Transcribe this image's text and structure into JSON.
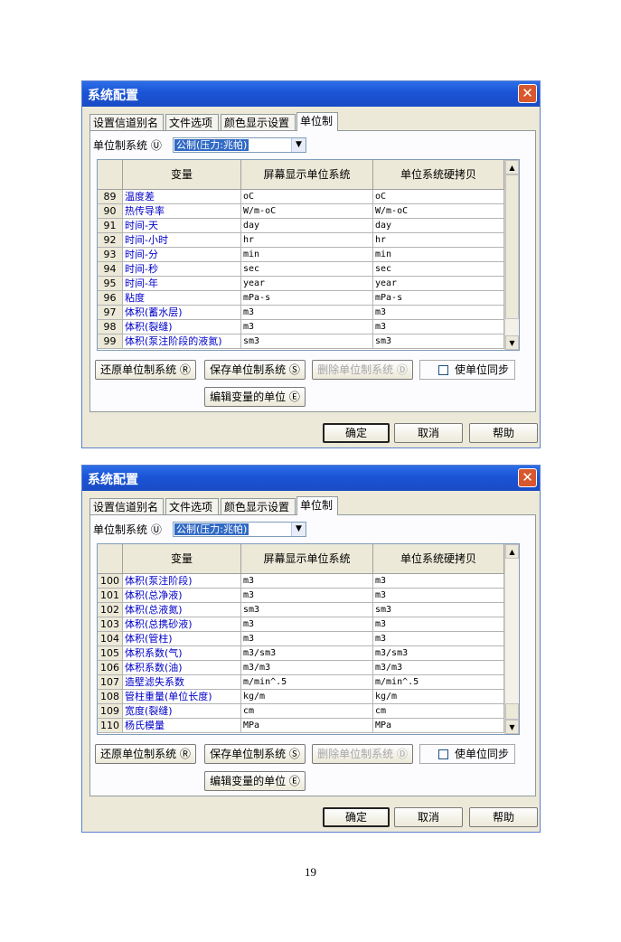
{
  "page_number": "19",
  "dialog1": {
    "title": "系统配置",
    "tabs": [
      "设置信道别名",
      "文件选项",
      "颜色显示设置",
      "单位制"
    ],
    "unit_system_label": "单位制系统 Ⓤ",
    "unit_system_value": "公制(压力:兆帕)",
    "headers": {
      "variable": "变量",
      "screen": "屏幕显示单位系统",
      "hardcopy": "单位系统硬拷贝"
    },
    "rows": [
      {
        "n": "89",
        "var": "温度差",
        "scr": "oC",
        "hc": "oC"
      },
      {
        "n": "90",
        "var": "热传导率",
        "scr": "W/m-oC",
        "hc": "W/m-oC"
      },
      {
        "n": "91",
        "var": "时间-天",
        "scr": "day",
        "hc": "day"
      },
      {
        "n": "92",
        "var": "时间-小时",
        "scr": "hr",
        "hc": "hr"
      },
      {
        "n": "93",
        "var": "时间-分",
        "scr": "min",
        "hc": "min"
      },
      {
        "n": "94",
        "var": "时间-秒",
        "scr": "sec",
        "hc": "sec"
      },
      {
        "n": "95",
        "var": "时间-年",
        "scr": "year",
        "hc": "year"
      },
      {
        "n": "96",
        "var": "粘度",
        "scr": "mPa-s",
        "hc": "mPa-s"
      },
      {
        "n": "97",
        "var": "体积(蓄水层)",
        "scr": "m3",
        "hc": "m3"
      },
      {
        "n": "98",
        "var": "体积(裂缝)",
        "scr": "m3",
        "hc": "m3"
      },
      {
        "n": "99",
        "var": "体积(泵注阶段的液氮)",
        "scr": "sm3",
        "hc": "sm3"
      }
    ],
    "buttons": {
      "restore": "还原单位制系统 Ⓡ",
      "save": "保存单位制系统 Ⓢ",
      "delete": "删除单位制系统 Ⓓ",
      "sync": "使单位同步",
      "edit": "编辑变量的单位 Ⓔ",
      "ok": "确定",
      "cancel": "取消",
      "help": "帮助"
    }
  },
  "dialog2": {
    "title": "系统配置",
    "tabs": [
      "设置信道别名",
      "文件选项",
      "颜色显示设置",
      "单位制"
    ],
    "unit_system_label": "单位制系统 Ⓤ",
    "unit_system_value": "公制(压力:兆帕)",
    "headers": {
      "variable": "变量",
      "screen": "屏幕显示单位系统",
      "hardcopy": "单位系统硬拷贝"
    },
    "rows": [
      {
        "n": "100",
        "var": "体积(泵注阶段)",
        "scr": "m3",
        "hc": "m3"
      },
      {
        "n": "101",
        "var": "体积(总净液)",
        "scr": "m3",
        "hc": "m3"
      },
      {
        "n": "102",
        "var": "体积(总液氮)",
        "scr": "sm3",
        "hc": "sm3"
      },
      {
        "n": "103",
        "var": "体积(总携砂液)",
        "scr": "m3",
        "hc": "m3"
      },
      {
        "n": "104",
        "var": "体积(管柱)",
        "scr": "m3",
        "hc": "m3"
      },
      {
        "n": "105",
        "var": "体积系数(气)",
        "scr": "m3/sm3",
        "hc": "m3/sm3"
      },
      {
        "n": "106",
        "var": "体积系数(油)",
        "scr": "m3/m3",
        "hc": "m3/m3"
      },
      {
        "n": "107",
        "var": "造壁滤失系数",
        "scr": "m/min^.5",
        "hc": "m/min^.5"
      },
      {
        "n": "108",
        "var": "管柱重量(单位长度)",
        "scr": "kg/m",
        "hc": "kg/m"
      },
      {
        "n": "109",
        "var": "宽度(裂缝)",
        "scr": "cm",
        "hc": "cm"
      },
      {
        "n": "110",
        "var": "杨氏模量",
        "scr": "MPa",
        "hc": "MPa"
      }
    ],
    "buttons": {
      "restore": "还原单位制系统 Ⓡ",
      "save": "保存单位制系统 Ⓢ",
      "delete": "删除单位制系统 Ⓓ",
      "sync": "使单位同步",
      "edit": "编辑变量的单位 Ⓔ",
      "ok": "确定",
      "cancel": "取消",
      "help": "帮助"
    }
  }
}
